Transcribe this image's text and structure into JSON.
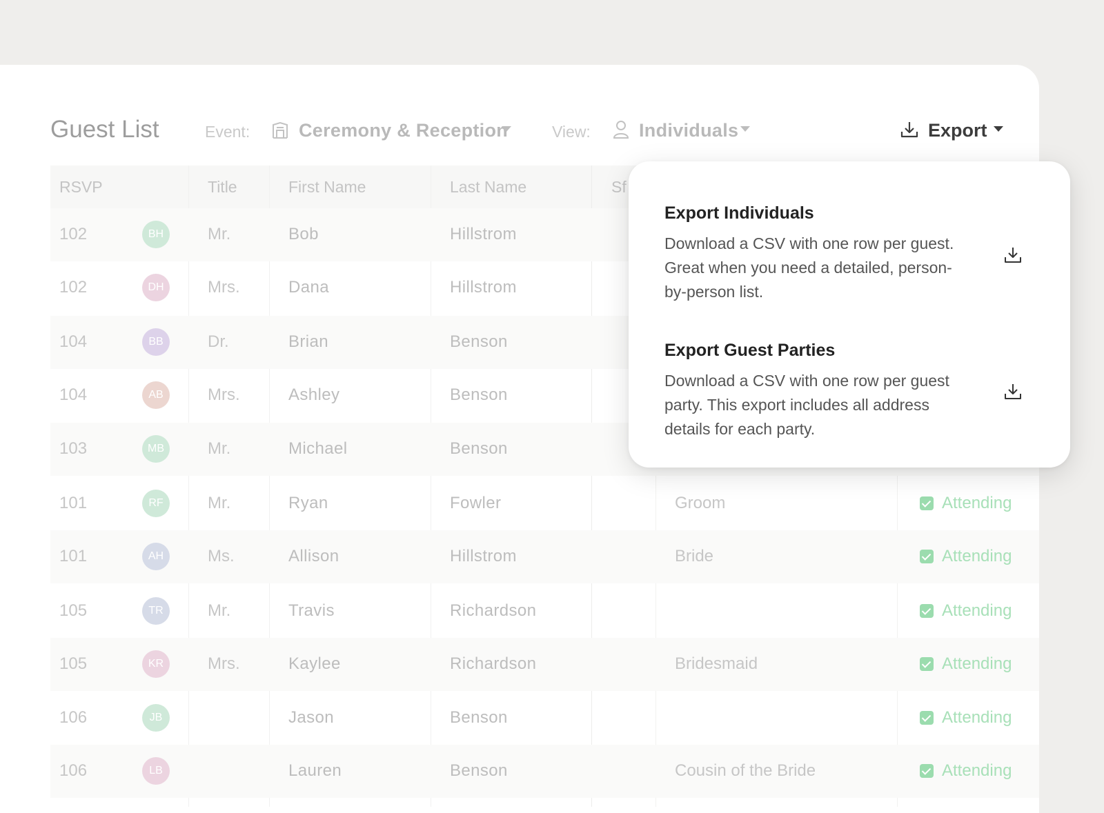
{
  "header": {
    "title": "Guest List",
    "event_label": "Event:",
    "event_value": "Ceremony & Reception",
    "view_label": "View:",
    "view_value": "Individuals",
    "export_label": "Export"
  },
  "table": {
    "columns": [
      "RSVP",
      "Title",
      "First Name",
      "Last Name",
      "Sf"
    ],
    "rows": [
      {
        "rsvp": "102",
        "initials": "BH",
        "title": "Mr.",
        "first": "Bob",
        "last": "Hillstrom",
        "role": "",
        "status": ""
      },
      {
        "rsvp": "102",
        "initials": "DH",
        "title": "Mrs.",
        "first": "Dana",
        "last": "Hillstrom",
        "role": "",
        "status": ""
      },
      {
        "rsvp": "104",
        "initials": "BB",
        "title": "Dr.",
        "first": "Brian",
        "last": "Benson",
        "role": "",
        "status": ""
      },
      {
        "rsvp": "104",
        "initials": "AB",
        "title": "Mrs.",
        "first": "Ashley",
        "last": "Benson",
        "role": "",
        "status": ""
      },
      {
        "rsvp": "103",
        "initials": "MB",
        "title": "Mr.",
        "first": "Michael",
        "last": "Benson",
        "role": "",
        "status": ""
      },
      {
        "rsvp": "101",
        "initials": "RF",
        "title": "Mr.",
        "first": "Ryan",
        "last": "Fowler",
        "role": "Groom",
        "status": "Attending"
      },
      {
        "rsvp": "101",
        "initials": "AH",
        "title": "Ms.",
        "first": "Allison",
        "last": "Hillstrom",
        "role": "Bride",
        "status": "Attending"
      },
      {
        "rsvp": "105",
        "initials": "TR",
        "title": "Mr.",
        "first": "Travis",
        "last": "Richardson",
        "role": "",
        "status": "Attending"
      },
      {
        "rsvp": "105",
        "initials": "KR",
        "title": "Mrs.",
        "first": "Kaylee",
        "last": "Richardson",
        "role": "Bridesmaid",
        "status": "Attending"
      },
      {
        "rsvp": "106",
        "initials": "JB",
        "title": "",
        "first": "Jason",
        "last": "Benson",
        "role": "",
        "status": "Attending"
      },
      {
        "rsvp": "106",
        "initials": "LB",
        "title": "",
        "first": "Lauren",
        "last": "Benson",
        "role": "Cousin of the Bride",
        "status": "Attending"
      }
    ]
  },
  "export_menu": {
    "items": [
      {
        "title": "Export Individuals",
        "line1": "Download a CSV with one row per guest.",
        "line2": "Great when you need a detailed, person-",
        "line3": "by-person list."
      },
      {
        "title": "Export Guest Parties",
        "line1": "Download a CSV with one row per guest",
        "line2": "party. This export includes all address",
        "line3": "details for each party."
      }
    ]
  },
  "colors": {
    "background": "#efeeec",
    "card": "#ffffff",
    "attending": "#9bdcae",
    "avatar_green": "#cfe9d9",
    "avatar_pink": "#ecd4e0",
    "avatar_purple": "#ddd2ea",
    "avatar_peach": "#ecd6d0",
    "avatar_blue": "#d6dbe8"
  },
  "icons": {
    "event": "building-icon",
    "view": "person-icon",
    "export": "download-icon"
  }
}
